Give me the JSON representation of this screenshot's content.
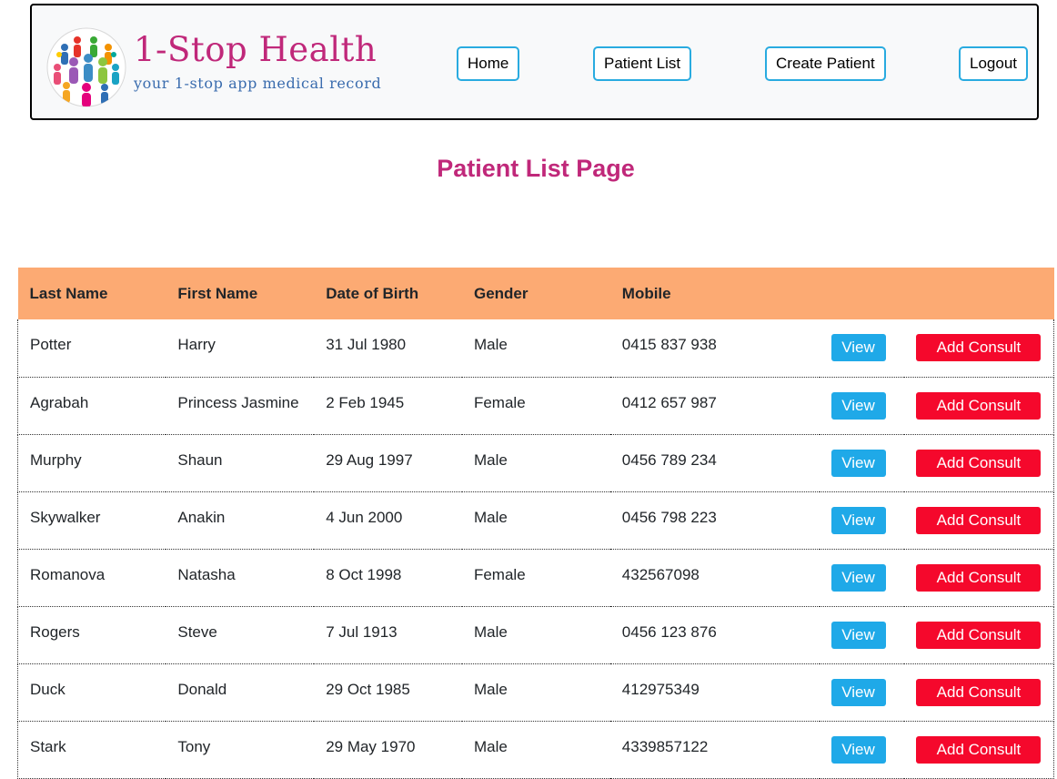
{
  "brand": {
    "title": "1-Stop Health",
    "subtitle": "your 1-stop app medical record",
    "logo_icon": "globe-people-icon",
    "title_color": "#c0287a",
    "subtitle_color": "#3a6cae"
  },
  "nav": {
    "home": "Home",
    "patient_list": "Patient List",
    "create_patient": "Create Patient",
    "logout": "Logout"
  },
  "page": {
    "title": "Patient List Page"
  },
  "table": {
    "header_color": "#fcaa73",
    "columns": [
      "Last Name",
      "First Name",
      "Date of Birth",
      "Gender",
      "Mobile"
    ],
    "view_label": "View",
    "consult_label": "Add Consult",
    "view_color": "#1fa9e8",
    "consult_color": "#f5082c",
    "rows": [
      [
        "Potter",
        "Harry",
        "31 Jul 1980",
        "Male",
        "0415 837 938"
      ],
      [
        "Agrabah",
        "Princess Jasmine",
        "2 Feb 1945",
        "Female",
        "0412 657 987"
      ],
      [
        "Murphy",
        "Shaun",
        "29 Aug 1997",
        "Male",
        "0456 789 234"
      ],
      [
        "Skywalker",
        "Anakin",
        "4 Jun 2000",
        "Male",
        "0456 798 223"
      ],
      [
        "Romanova",
        "Natasha",
        "8 Oct 1998",
        "Female",
        "432567098"
      ],
      [
        "Rogers",
        "Steve",
        "7 Jul 1913",
        "Male",
        "0456 123 876"
      ],
      [
        "Duck",
        "Donald",
        "29 Oct 1985",
        "Male",
        "412975349"
      ],
      [
        "Stark",
        "Tony",
        "29 May 1970",
        "Male",
        "4339857122"
      ]
    ]
  }
}
